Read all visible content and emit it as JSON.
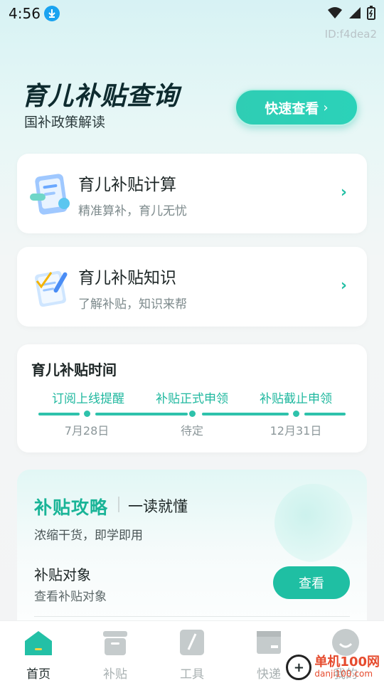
{
  "status": {
    "time": "4:56"
  },
  "id_tag": "ID:f4dea2",
  "header": {
    "title": "育儿补贴查询",
    "subtitle": "国补政策解读",
    "quick_button": "快速查看"
  },
  "cards": [
    {
      "title": "育儿补贴计算",
      "subtitle": "精准算补，育儿无忧"
    },
    {
      "title": "育儿补贴知识",
      "subtitle": "了解补贴，知识来帮"
    }
  ],
  "timeline": {
    "title": "育儿补贴时间",
    "steps": [
      {
        "label": "订阅上线提醒",
        "date": "7月28日"
      },
      {
        "label": "补贴正式申领",
        "date": "待定"
      },
      {
        "label": "补贴截止申领",
        "date": "12月31日"
      }
    ]
  },
  "guide": {
    "title": "补贴攻略",
    "subtitle": "一读就懂",
    "desc": "浓缩干货，即学即用",
    "item_title": "补贴对象",
    "item_sub": "查看补贴对象",
    "view_button": "查看"
  },
  "tabs": [
    {
      "label": "首页"
    },
    {
      "label": "补贴"
    },
    {
      "label": "工具"
    },
    {
      "label": "快递"
    },
    {
      "label": "我的"
    }
  ],
  "watermark": {
    "line1": "单机100网",
    "line2": "danji100.com"
  },
  "colors": {
    "accent": "#1fbfa3",
    "title": "#0e2b2f"
  }
}
